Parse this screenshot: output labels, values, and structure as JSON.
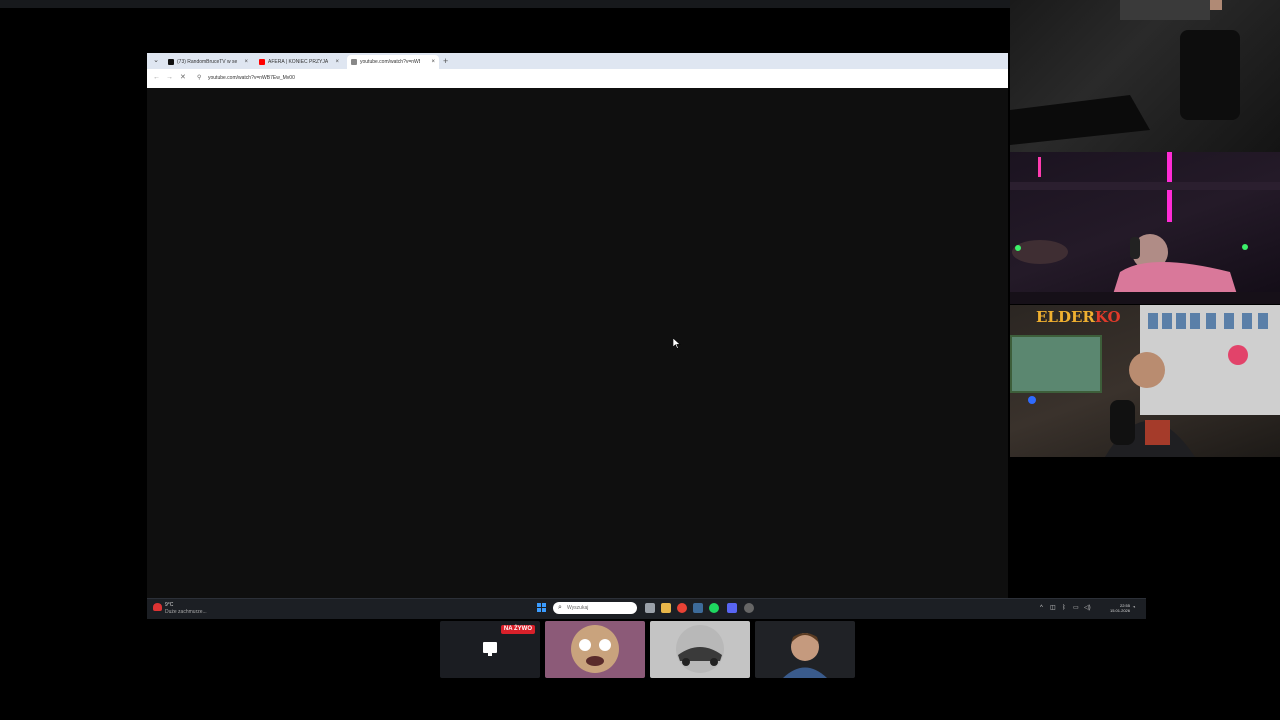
{
  "browser": {
    "tabs": [
      {
        "title": "(73) RandomBruceTV w serwisie X",
        "favicon_color": "#111111",
        "active": false
      },
      {
        "title": "AFERA | KONIEC PRZYJAŹNI Z ...",
        "favicon_color": "#ff0000",
        "active": false
      },
      {
        "title": "youtube.com/watch?v=nWB7Ew_Mv00",
        "favicon_color": "#888888",
        "active": true
      }
    ],
    "new_tab_label": "+",
    "tab_dropdown_icon": "chevron-down-icon",
    "close_glyph": "×",
    "url": "youtube.com/watch?v=nWB7Ew_Mv00"
  },
  "taskbar": {
    "weather_temp": "9°C",
    "weather_text": "Duże zachmurze...",
    "search_placeholder": "Wyszukaj",
    "pinned_apps": [
      {
        "name": "task-view",
        "color": "#9aa0a8"
      },
      {
        "name": "file-explorer",
        "color": "#e8b64a"
      },
      {
        "name": "chrome",
        "color": "#e94235"
      },
      {
        "name": "steam",
        "color": "#3d6b9a"
      },
      {
        "name": "spotify",
        "color": "#1ed760"
      },
      {
        "name": "discord",
        "color": "#5865f2"
      },
      {
        "name": "obs",
        "color": "#666666"
      }
    ],
    "clock_time": "22:55",
    "clock_date": "15.01.2026"
  },
  "webcams": {
    "cam3_logo_main": "ELDER",
    "cam3_logo_accent": "KO"
  },
  "participants": {
    "live_badge": "NA ŻYWO"
  }
}
